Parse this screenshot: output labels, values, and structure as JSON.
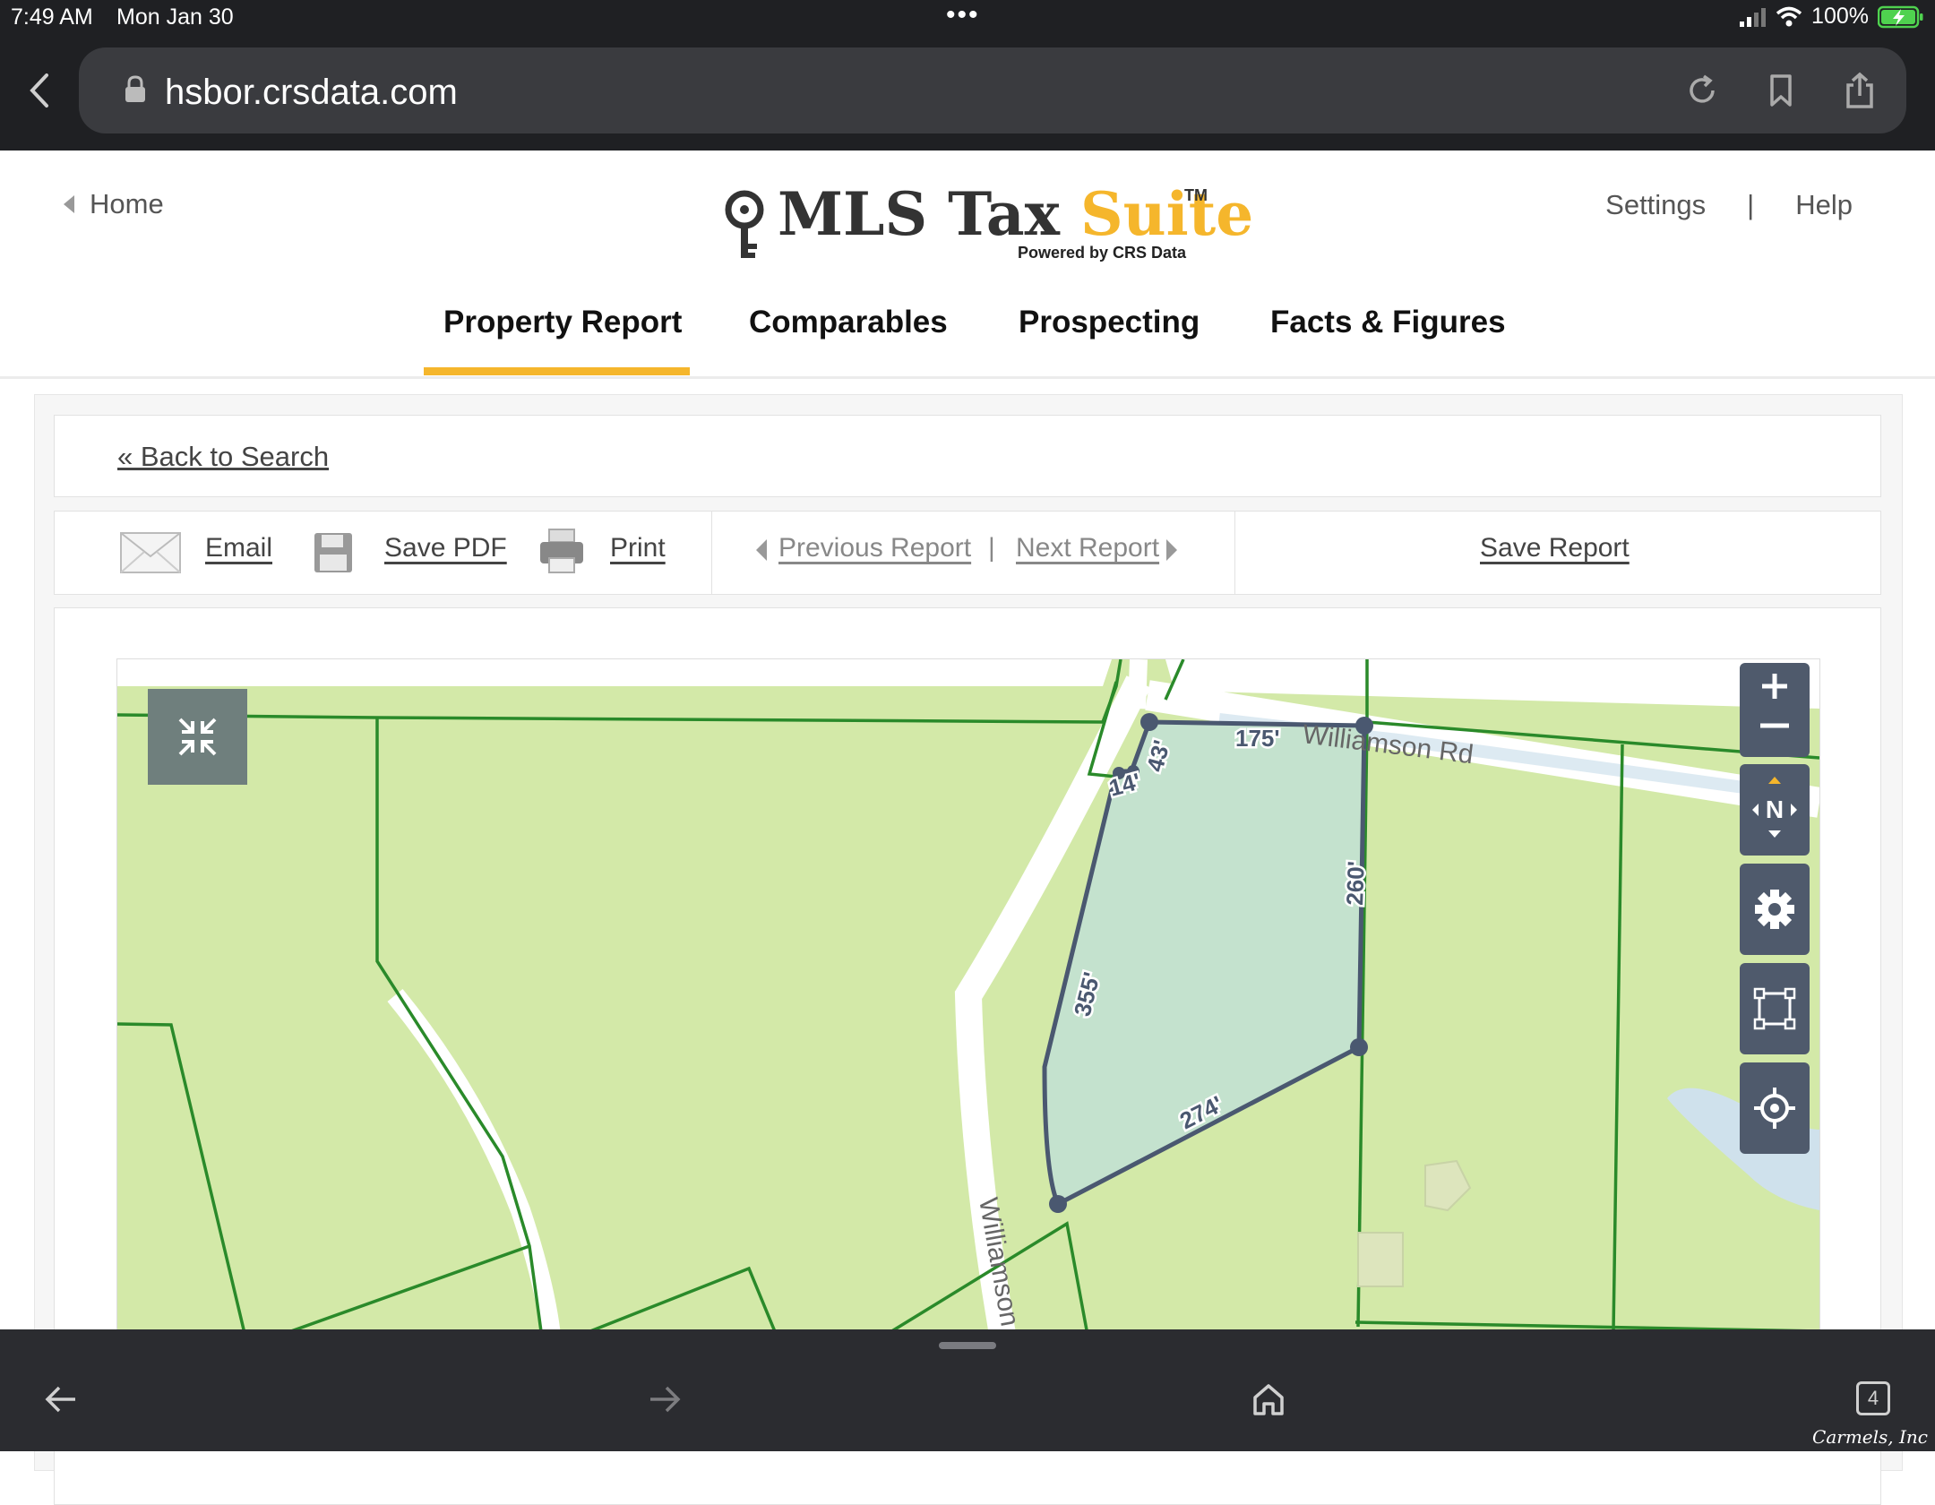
{
  "status": {
    "time": "7:49 AM",
    "date": "Mon Jan 30",
    "battery": "100%"
  },
  "browser": {
    "url": "hsbor.crsdata.com",
    "tab_count": "4"
  },
  "header": {
    "home": "Home",
    "logo_main": "MLS Tax ",
    "logo_accent": "Suite",
    "logo_tm": "TM",
    "logo_tagline": "Powered by CRS Data",
    "settings": "Settings",
    "separator": "|",
    "help": "Help"
  },
  "tabs": [
    {
      "label": "Property Report",
      "active": true
    },
    {
      "label": "Comparables"
    },
    {
      "label": "Prospecting"
    },
    {
      "label": "Facts & Figures"
    }
  ],
  "back_to_search": "« Back to Search",
  "toolbar": {
    "email": "Email",
    "save_pdf": "Save PDF",
    "print": "Print",
    "previous_report": "Previous Report",
    "report_sep": "|",
    "next_report": "Next Report",
    "save_report": "Save Report"
  },
  "map": {
    "road_label_top": "Williamson Rd",
    "road_label_side": "Williamson",
    "compass": "N",
    "dimensions": {
      "top": "175'",
      "right": "260'",
      "bottom": "274'",
      "left": "355'",
      "short1": "14'",
      "short2": "43'"
    },
    "colors": {
      "land": "#d3e9a8",
      "parcel_line": "#2a8a2a",
      "selected_fill": "#c4e2ce",
      "selected_stroke": "#4a5870",
      "road": "#ffffff",
      "water": "#cfe1ec"
    }
  },
  "watermark": "Carmels, Inc"
}
